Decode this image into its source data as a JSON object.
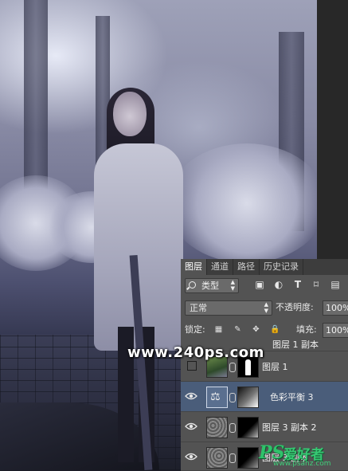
{
  "watermark": {
    "site": "www.240ps.com"
  },
  "brand": {
    "logo": "PS",
    "chinese": "爱好者",
    "url": "www.psahz.com"
  },
  "layers_panel": {
    "tabs": [
      {
        "label": "图层",
        "active": true
      },
      {
        "label": "通道",
        "active": false
      },
      {
        "label": "路径",
        "active": false
      },
      {
        "label": "历史记录",
        "active": false
      }
    ],
    "filter": {
      "value": "类型",
      "icons": [
        "image-filter-icon",
        "adjustment-filter-icon",
        "type-filter-icon",
        "shape-filter-icon",
        "smart-object-filter-icon"
      ]
    },
    "blend_mode": "正常",
    "opacity_label": "不透明度:",
    "opacity_value": "100%",
    "lock_label": "锁定:",
    "lock_icons": [
      "lock-transparent-icon",
      "lock-paint-icon",
      "lock-position-icon",
      "lock-all-icon"
    ],
    "fill_label": "填充:",
    "fill_value": "100%",
    "layers": [
      {
        "name": "图层 1 副本",
        "visible": false,
        "partial": true
      },
      {
        "name": "图层 1",
        "visible": false,
        "selected": false
      },
      {
        "name": "色彩平衡 3",
        "visible": true,
        "selected": true,
        "type": "adjustment"
      },
      {
        "name": "图层 3 副本 2",
        "visible": true,
        "selected": false
      },
      {
        "name": "图层 3 副本",
        "visible": true,
        "selected": false,
        "partial": true
      }
    ]
  },
  "colors": {
    "panel_bg": "#535353",
    "tab_bar": "#3d3d3d",
    "selected_layer": "#4a5d7a",
    "brand_green": "#2fc26a"
  }
}
